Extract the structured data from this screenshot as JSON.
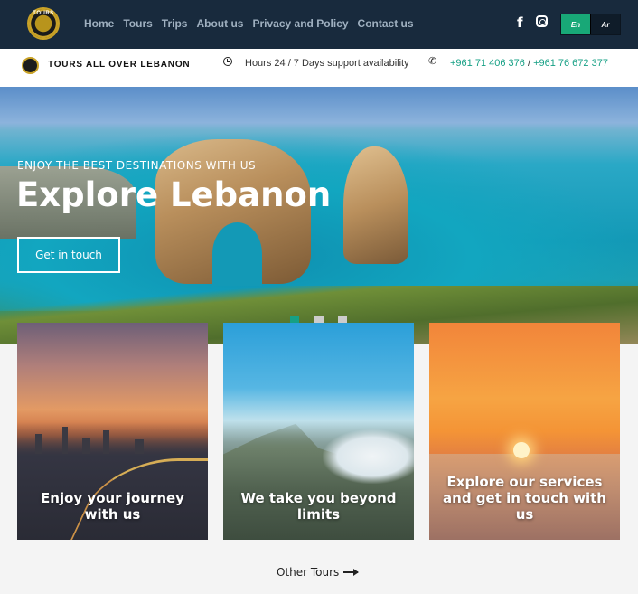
{
  "nav": {
    "logo_text": "TOURS",
    "links": [
      "Home",
      "Tours",
      "Trips",
      "About us",
      "Privacy and Policy",
      "Contact us"
    ],
    "social_icons": [
      "facebook-icon",
      "instagram-icon"
    ],
    "lang": {
      "en": "En",
      "ar": "Ar"
    },
    "colors": {
      "bg": "#182a3d",
      "active": "#18a877"
    }
  },
  "infobar": {
    "brand": "TOURS ALL OVER LEBANON",
    "hours": "Hours 24 / 7 Days support availability",
    "phone1": "+961 71 406 376",
    "separator": " / ",
    "phone2": "+961 76 672 377"
  },
  "hero": {
    "subtitle": "ENJOY THE BEST DESTINATIONS WITH US",
    "title": "Explore Lebanon",
    "button": "Get in touch",
    "slides": 3,
    "active_slide": 1
  },
  "cards": [
    {
      "title": "Enjoy your journey with us"
    },
    {
      "title": "We take you beyond limits"
    },
    {
      "title": "Explore our services and get in touch with us"
    }
  ],
  "footer": {
    "other_tours": "Other Tours"
  }
}
